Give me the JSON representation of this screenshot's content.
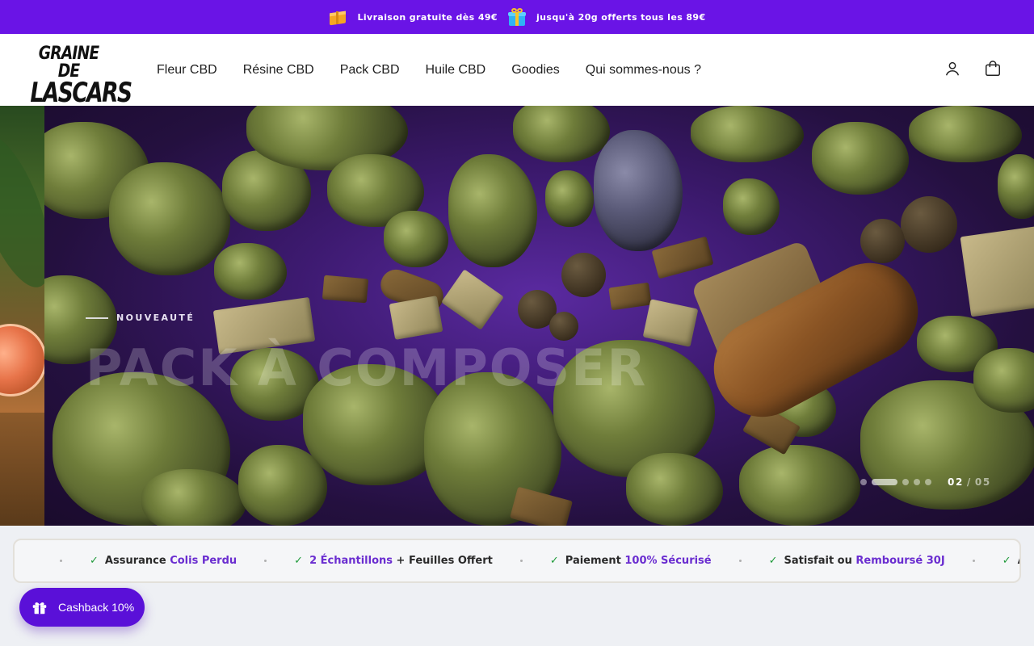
{
  "announcement": {
    "item1": {
      "icon": "package-icon",
      "text": "Livraison gratuite dès 49€"
    },
    "item2": {
      "icon": "gift-icon",
      "text": "jusqu'à 20g offerts tous les 89€"
    },
    "bg_color": "#6a14e6"
  },
  "header": {
    "logo_line1": "GRAINE DE",
    "logo_line2": "LASCARS",
    "nav": [
      "Fleur CBD",
      "Résine CBD",
      "Pack CBD",
      "Huile CBD",
      "Goodies",
      "Qui sommes-nous ?"
    ],
    "account_icon": "user-icon",
    "cart_icon": "cart-icon"
  },
  "hero": {
    "kicker": "NOUVEAUTÉ",
    "title": "PACK À COMPOSER",
    "current_slide": "02",
    "total_slides": "05",
    "slide_count": 5,
    "active_slide_index": 1
  },
  "trust_bar": {
    "items": [
      {
        "prefix": "Assurance ",
        "highlight": "Colis Perdu",
        "suffix": ""
      },
      {
        "prefix": "",
        "highlight": "2 Échantillons",
        "suffix": " + Feuilles Offert"
      },
      {
        "prefix": "Paiement ",
        "highlight": "100% Sécurisé",
        "suffix": ""
      },
      {
        "prefix": "Satisfait ou ",
        "highlight": "Remboursé 30J",
        "suffix": ""
      },
      {
        "prefix": "Assura",
        "highlight": "",
        "suffix": ""
      }
    ],
    "accent_color": "#6a2dd0",
    "check_color": "#1f9a3a"
  },
  "cashback": {
    "label": "Cashback 10%",
    "icon": "gift-icon",
    "bg_color": "#5a10d8"
  }
}
